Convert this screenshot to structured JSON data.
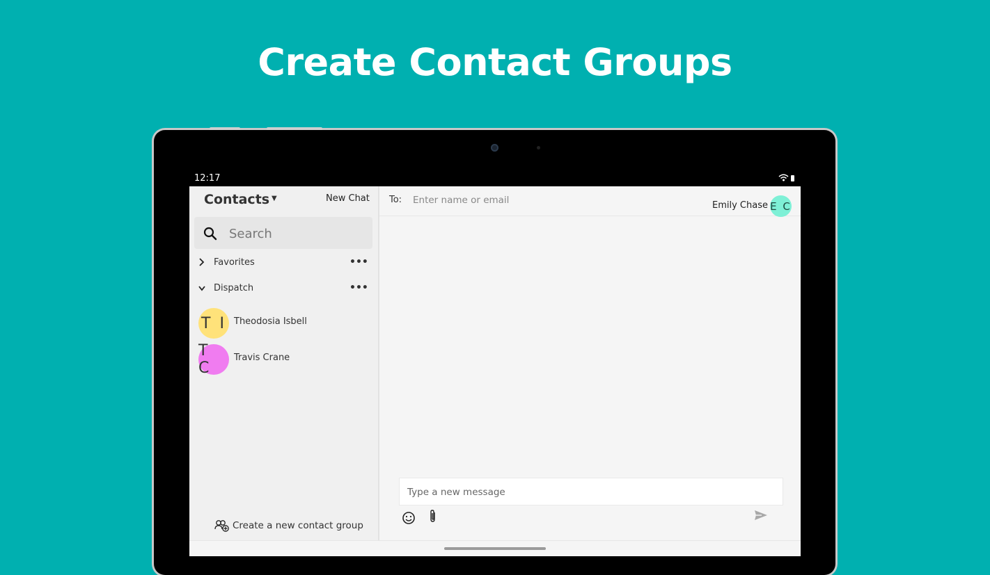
{
  "headline": "Create Contact Groups",
  "status_bar": {
    "time": "12:17"
  },
  "contacts_panel": {
    "title": "Contacts",
    "new_chat_label": "New Chat",
    "search_placeholder": "Search",
    "groups": [
      {
        "label": "Favorites",
        "expanded": false
      },
      {
        "label": "Dispatch",
        "expanded": true
      }
    ],
    "contacts": [
      {
        "initials": "T I",
        "name": "Theodosia Isbell",
        "avatar_color": "#ffe27a"
      },
      {
        "initials": "T C",
        "name": "Travis Crane",
        "avatar_color": "#f07cf0"
      }
    ],
    "create_group_label": "Create a new contact group"
  },
  "chat_panel": {
    "to_label": "To:",
    "to_placeholder": "Enter name or email",
    "user": {
      "name": "Emily Chase",
      "initials": "E C",
      "avatar_color": "#7ef0d6"
    },
    "message_placeholder": "Type a new message"
  },
  "colors": {
    "background": "#00b0b0",
    "accent": "#7ef0d6"
  }
}
